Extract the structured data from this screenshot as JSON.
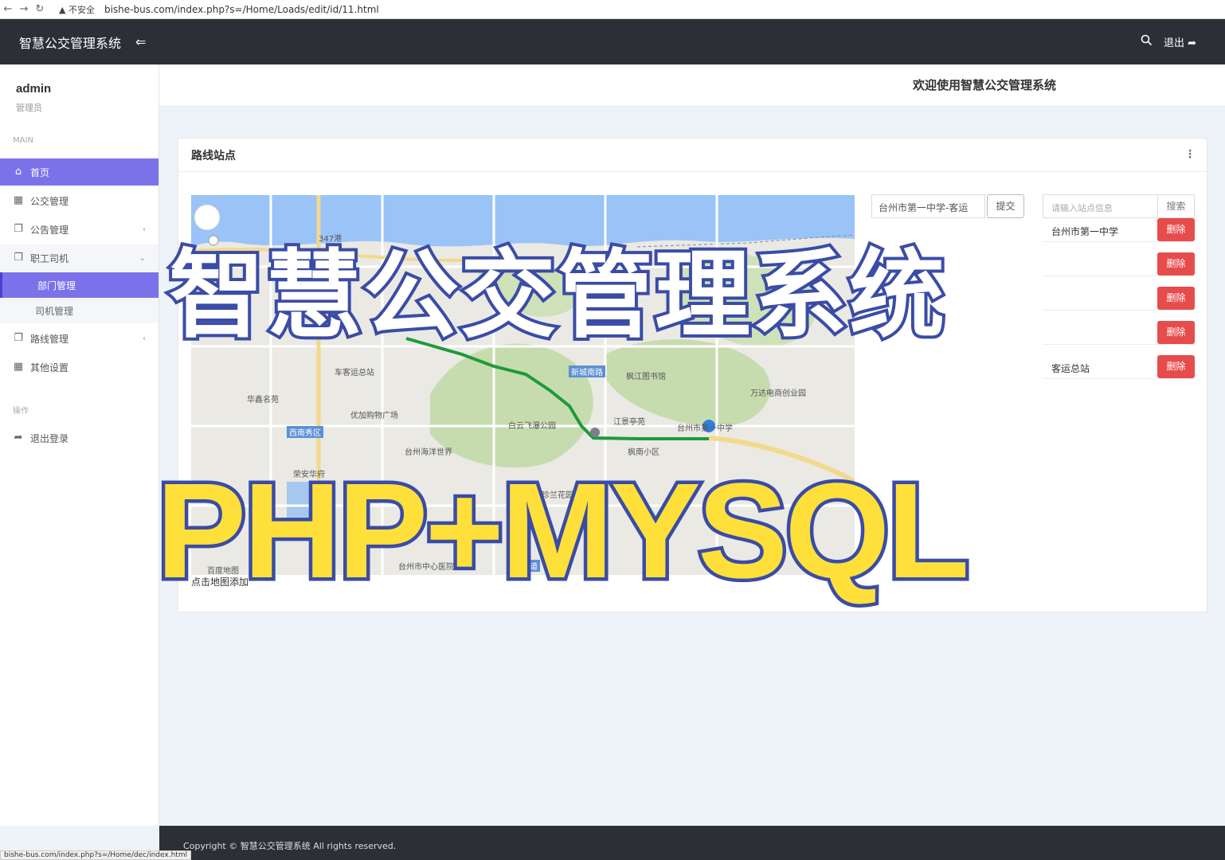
{
  "browser": {
    "security_warning": "不安全",
    "url": "bishe-bus.com/index.php?s=/Home/Loads/edit/id/11.html",
    "status_url": "bishe-bus.com/index.php?s=/Home/dec/index.html"
  },
  "header": {
    "app_title": "智慧公交管理系统",
    "logout_label": "退出"
  },
  "sidebar": {
    "user_name": "admin",
    "user_role": "管理员",
    "section_main": "MAIN",
    "section_ops": "操作",
    "items": [
      {
        "label": "首页",
        "icon": "home-icon"
      },
      {
        "label": "公交管理",
        "icon": "grid-icon"
      },
      {
        "label": "公告管理",
        "icon": "copy-icon"
      },
      {
        "label": "职工司机",
        "icon": "copy-icon"
      },
      {
        "label": "路线管理",
        "icon": "copy-icon"
      },
      {
        "label": "其他设置",
        "icon": "grid-icon"
      }
    ],
    "sub_items": [
      {
        "label": "部门管理"
      },
      {
        "label": "司机管理"
      }
    ],
    "logout_item": "退出登录"
  },
  "welcome": {
    "text": "欢迎使用智慧公交管理系统"
  },
  "card": {
    "title": "路线站点",
    "map_footer": "点击地图添加",
    "map_labels": {
      "a": "347港",
      "b": "车客运总站",
      "c": "华鑫名苑",
      "d": "优加购物广场",
      "e": "西南秀区",
      "f": "台州海洋世界",
      "g": "荣安华府",
      "h": "台州市中心医院",
      "i": "白云飞瀑公园",
      "j": "新城南路",
      "k": "枫江图书馆",
      "l": "万达电商创业园",
      "m": "江景亭苑",
      "n": "枫南小区",
      "o": "台州市第一中学",
      "p": "珍兰花园",
      "q": "百度地图",
      "r": "大道"
    },
    "stop_input_value": "台州市第一中学-客运",
    "submit_label": "提交",
    "search_placeholder": "请输入站点信息",
    "search_label": "搜索",
    "stops": [
      {
        "name": "台州市第一中学"
      },
      {
        "name": ""
      },
      {
        "name": ""
      },
      {
        "name": ""
      },
      {
        "name": "客运总站"
      }
    ],
    "delete_label": "删除"
  },
  "footer": {
    "text": "Copyright © 智慧公交管理系统 All rights reserved."
  },
  "overlay": {
    "title": "智慧公交管理系统",
    "subtitle": "PHP+MYSQL"
  },
  "colors": {
    "accent": "#7b72e9",
    "topbar": "#2c3036",
    "danger": "#e74c4c",
    "overlay_stroke": "#3a4ca6",
    "overlay_yellow": "#ffe03a"
  }
}
